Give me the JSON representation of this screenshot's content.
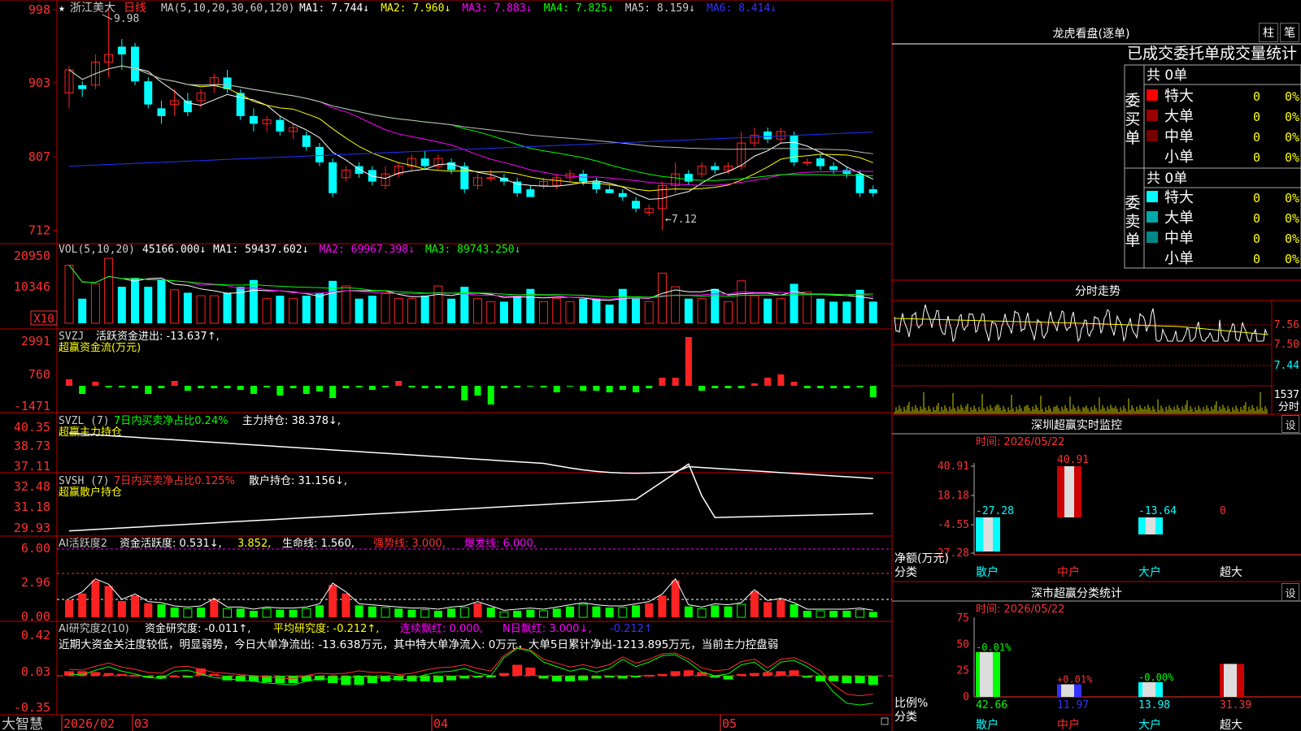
{
  "colors": {
    "up": "#ff2222",
    "down": "#00ffff",
    "bg": "#000000",
    "frame": "#c00000",
    "white": "#ffffff",
    "yellow": "#ffff00",
    "magenta": "#ff00ff",
    "green": "#00ff00",
    "blue": "#2222ff",
    "gray": "#aaaaaa"
  },
  "main": {
    "star": "★",
    "title": "浙江美大",
    "period": "日线",
    "ma_label": "MA(5,10,20,30,60,120)",
    "ma": [
      {
        "text": "MA1: 7.744↓",
        "color": "#ffffff"
      },
      {
        "text": "MA2: 7.960↓",
        "color": "#ffff00"
      },
      {
        "text": "MA3: 7.883↓",
        "color": "#ff00ff"
      },
      {
        "text": "MA4: 7.825↓",
        "color": "#00ff00"
      },
      {
        "text": "MA5: 8.159↓",
        "color": "#cccccc"
      },
      {
        "text": "MA6: 8.414↓",
        "color": "#3333ff"
      }
    ],
    "yticks": [
      "998",
      "903",
      "807",
      "712"
    ],
    "hi_label": "9.98",
    "lo_label": "←7.12",
    "chart_data": {
      "type": "candlestick",
      "yrange": [
        7.05,
        10.0
      ],
      "candles": [
        [
          8.9,
          9.2,
          8.7,
          9.25
        ],
        [
          9.0,
          8.95,
          8.85,
          9.05
        ],
        [
          9.0,
          9.3,
          8.95,
          9.4
        ],
        [
          9.3,
          9.4,
          9.1,
          9.98
        ],
        [
          9.5,
          9.4,
          9.2,
          9.6
        ],
        [
          9.5,
          9.05,
          9.0,
          9.55
        ],
        [
          9.05,
          8.75,
          8.7,
          9.1
        ],
        [
          8.7,
          8.6,
          8.5,
          8.8
        ],
        [
          8.75,
          8.8,
          8.6,
          8.95
        ],
        [
          8.8,
          8.65,
          8.6,
          8.9
        ],
        [
          8.8,
          8.9,
          8.7,
          8.95
        ],
        [
          9.0,
          9.1,
          8.9,
          9.15
        ],
        [
          9.1,
          8.95,
          8.9,
          9.2
        ],
        [
          8.9,
          8.6,
          8.55,
          8.95
        ],
        [
          8.6,
          8.5,
          8.4,
          8.7
        ],
        [
          8.5,
          8.55,
          8.4,
          8.6
        ],
        [
          8.55,
          8.4,
          8.35,
          8.6
        ],
        [
          8.4,
          8.45,
          8.3,
          8.5
        ],
        [
          8.35,
          8.2,
          8.15,
          8.4
        ],
        [
          8.2,
          8.0,
          7.95,
          8.25
        ],
        [
          8.0,
          7.6,
          7.55,
          8.05
        ],
        [
          7.8,
          7.9,
          7.75,
          7.95
        ],
        [
          7.95,
          7.85,
          7.8,
          8.0
        ],
        [
          7.9,
          7.75,
          7.7,
          7.95
        ],
        [
          7.7,
          7.85,
          7.65,
          7.95
        ],
        [
          7.85,
          7.95,
          7.8,
          8.0
        ],
        [
          7.95,
          8.05,
          7.9,
          8.1
        ],
        [
          8.05,
          7.95,
          7.9,
          8.15
        ],
        [
          7.95,
          8.05,
          7.9,
          8.1
        ],
        [
          8.0,
          7.9,
          7.85,
          8.05
        ],
        [
          7.95,
          7.65,
          7.6,
          8.0
        ],
        [
          7.7,
          7.8,
          7.65,
          7.85
        ],
        [
          7.8,
          7.8,
          7.75,
          7.9
        ],
        [
          7.8,
          7.75,
          7.7,
          7.85
        ],
        [
          7.75,
          7.6,
          7.55,
          7.8
        ],
        [
          7.65,
          7.55,
          7.55,
          7.7
        ],
        [
          7.7,
          7.75,
          7.65,
          7.8
        ],
        [
          7.7,
          7.8,
          7.65,
          7.85
        ],
        [
          7.8,
          7.85,
          7.75,
          7.9
        ],
        [
          7.85,
          7.75,
          7.7,
          7.9
        ],
        [
          7.75,
          7.65,
          7.6,
          7.8
        ],
        [
          7.65,
          7.6,
          7.6,
          7.7
        ],
        [
          7.6,
          7.55,
          7.5,
          7.65
        ],
        [
          7.5,
          7.4,
          7.35,
          7.55
        ],
        [
          7.35,
          7.4,
          7.3,
          7.45
        ],
        [
          7.4,
          7.7,
          7.12,
          7.75
        ],
        [
          7.7,
          7.85,
          7.6,
          8.0
        ],
        [
          7.85,
          7.75,
          7.7,
          7.9
        ],
        [
          7.85,
          7.95,
          7.8,
          8.0
        ],
        [
          7.95,
          7.9,
          7.85,
          8.0
        ],
        [
          7.9,
          7.95,
          7.85,
          8.0
        ],
        [
          7.95,
          8.25,
          7.9,
          8.4
        ],
        [
          8.25,
          8.35,
          8.2,
          8.45
        ],
        [
          8.4,
          8.3,
          8.25,
          8.45
        ],
        [
          8.3,
          8.4,
          8.25,
          8.45
        ],
        [
          8.35,
          8.0,
          7.95,
          8.4
        ],
        [
          8.0,
          8.0,
          7.95,
          8.05
        ],
        [
          8.05,
          7.95,
          7.9,
          8.1
        ],
        [
          7.95,
          7.9,
          7.85,
          8.0
        ],
        [
          7.9,
          7.85,
          7.8,
          7.95
        ],
        [
          7.85,
          7.6,
          7.55,
          7.9
        ],
        [
          7.65,
          7.6,
          7.55,
          7.7
        ]
      ]
    }
  },
  "vol": {
    "name": "VOL(5,10,20)",
    "val": "45166.000↓",
    "ma": [
      {
        "text": "MA1: 59437.602↓",
        "color": "#ffffff"
      },
      {
        "text": "MA2: 69967.398↓",
        "color": "#ff00ff"
      },
      {
        "text": "MA3: 89743.250↓",
        "color": "#00ff00"
      }
    ],
    "yticks": [
      "20950",
      "10346"
    ],
    "unit": "X10"
  },
  "svzj": {
    "name": "SVZJ",
    "label": "活跃资金进出: -13.637↑,",
    "sub": "超赢资金流(万元)",
    "yticks": [
      "2991",
      "760",
      "-1471"
    ]
  },
  "svzl": {
    "name": "SVZL (7)",
    "label1": "7日内买卖净占比0.24%",
    "label2": "主力持仓: 38.378↓,",
    "sub": "超赢主力持仓",
    "yticks": [
      "40.35",
      "38.73",
      "37.11"
    ]
  },
  "svsh": {
    "name": "SVSH (7)",
    "label1": "7日内买卖净占比0.125%",
    "label2": "散户持仓: 31.156↓,",
    "sub": "超赢散户持仓",
    "yticks": [
      "32.48",
      "31.18",
      "29.93"
    ]
  },
  "ai2": {
    "name": "AI活跃度2",
    "p1": "资金活跃度: 0.531↓,",
    "p2": "3.852,",
    "p3": "生命线: 1.560,",
    "p4": "强势线: 3.000,",
    "p5": "爆发线: 6.000,",
    "yticks": [
      "6.00",
      "2.96",
      "0.00"
    ]
  },
  "ai3": {
    "name": "AI研究度2(10)",
    "p1": "资金研究度: -0.011↑,",
    "p2": "平均研究度: -0.212↑,",
    "p3": "连续飘红: 0.000,",
    "p4": "N日飘红: 3.000↓,",
    "p5": "-0.212↑",
    "desc": "近期大资金关注度较低，明显弱势，今日大单净流出: -13.638万元，其中特大单净流入: 0万元，大单5日累计净出-1213.895万元，当前主力控盘弱",
    "yticks": [
      "0.42",
      "0.03",
      "-0.35"
    ]
  },
  "dates": [
    "2026/02",
    "03",
    "04",
    "05"
  ],
  "brand": "大智慧",
  "right": {
    "tab1": "柱",
    "tab2": "笔",
    "lhk": "龙虎看盘(逐单)",
    "stat_header": "已成交委托单成交量统计",
    "buy_total": "共 0单",
    "buy_side": "委买单",
    "sell_total": "共 0单",
    "sell_side": "委卖单",
    "buy_rows": [
      {
        "label": "特大",
        "v": "0",
        "p": "0%",
        "c": "#ff0000"
      },
      {
        "label": "大单",
        "v": "0",
        "p": "0%",
        "c": "#990000"
      },
      {
        "label": "中单",
        "v": "0",
        "p": "0%",
        "c": "#770000"
      },
      {
        "label": "小单",
        "v": "0",
        "p": "0%",
        "c": ""
      }
    ],
    "sell_rows": [
      {
        "label": "特大",
        "v": "0",
        "p": "0%",
        "c": "#00ffff"
      },
      {
        "label": "大单",
        "v": "0",
        "p": "0%",
        "c": "#00aaaa"
      },
      {
        "label": "中单",
        "v": "0",
        "p": "0%",
        "c": "#008888"
      },
      {
        "label": "小单",
        "v": "0",
        "p": "0%",
        "c": ""
      }
    ],
    "fenshi_title": "分时走势",
    "fenshi_yticks": [
      "7.56",
      "7.50",
      "7.44"
    ],
    "fenshi_vol": "1537",
    "fenshi_unit": "分时",
    "monitor_title": "深圳超赢实时监控",
    "monitor_time": "时间: 2026/05/22",
    "monitor_yticks": [
      "40.91",
      "18.18",
      "-4.55",
      "-27.28"
    ],
    "monitor_bars": [
      {
        "name": "散户",
        "value": -27.28,
        "label": "-27.28"
      },
      {
        "name": "中户",
        "value": 40.91,
        "label": "40.91"
      },
      {
        "name": "大户",
        "value": -13.64,
        "label": "-13.64"
      },
      {
        "name": "超大",
        "value": 0,
        "label": "0"
      }
    ],
    "monitor_ylabel": "净额(万元)",
    "monitor_xlabel": "分类",
    "class_title": "深市超赢分类统计",
    "class_time": "时间: 2026/05/22",
    "class_yticks": [
      "75",
      "50",
      "25",
      "0"
    ],
    "class_bars": [
      {
        "name": "散户",
        "value": 42.66,
        "label": "42.66",
        "delta": "-0.01%"
      },
      {
        "name": "中户",
        "value": 11.97,
        "label": "11.97",
        "delta": "+0.01%"
      },
      {
        "name": "大户",
        "value": 13.98,
        "label": "13.98",
        "delta": "-0.00%"
      },
      {
        "name": "超大",
        "value": 31.39,
        "label": "31.39",
        "delta": ""
      }
    ],
    "class_ylabel": "比例%",
    "class_xlabel": "分类",
    "set": "设"
  }
}
